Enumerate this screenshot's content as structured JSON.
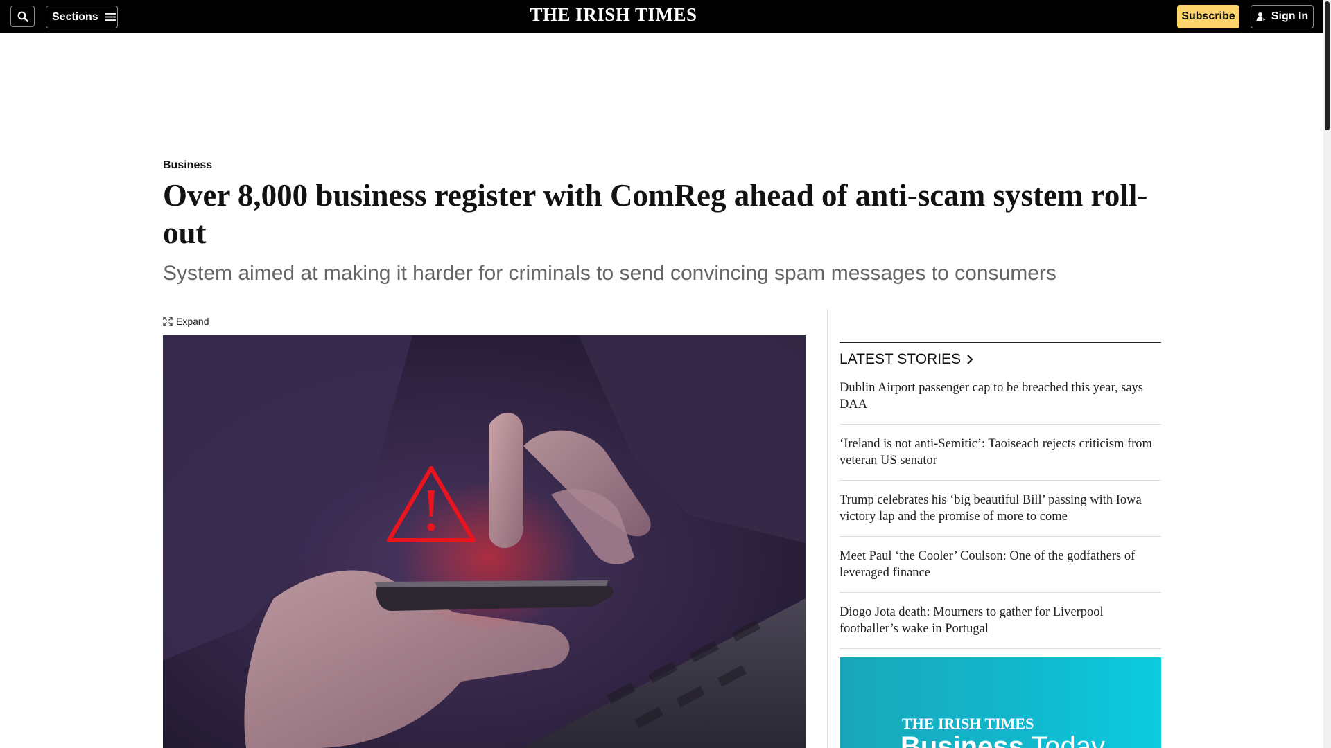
{
  "header": {
    "masthead": "THE IRISH TIMES",
    "sections_label": "Sections",
    "subscribe_label": "Subscribe",
    "signin_label": "Sign In"
  },
  "article": {
    "category": "Business",
    "headline": "Over 8,000 business register with ComReg ahead of anti-scam system roll-out",
    "standfirst": "System aimed at making it harder for criminals to send convincing spam messages to consumers",
    "expand_label": "Expand"
  },
  "latest_stories": {
    "title": "LATEST STORIES",
    "items": [
      {
        "title": "Dublin Airport passenger cap to be breached this year, says DAA"
      },
      {
        "title": "‘Ireland is not anti-Semitic’: Taoiseach rejects criticism from veteran US senator"
      },
      {
        "title": "Trump celebrates his ‘big beautiful Bill’ passing with Iowa victory lap and the promise of more to come"
      },
      {
        "title": "Meet Paul ‘the Cooler’ Coulson: One of the godfathers of leveraged finance"
      },
      {
        "title": "Diogo Jota death: Mourners to gather for Liverpool footballer’s wake in Portugal"
      }
    ]
  },
  "promo": {
    "brand": "THE IRISH TIMES",
    "name_bold": "Business",
    "name_light": " Today"
  },
  "colors": {
    "topbar": "#000000",
    "subscribe": "#fcd46b",
    "warning_red": "#e8141e",
    "promo_teal": "#12b7cc"
  },
  "icons": [
    "search-icon",
    "menu-icon",
    "user-icon",
    "expand-icon",
    "chevron-right-icon",
    "warning-triangle-icon"
  ]
}
